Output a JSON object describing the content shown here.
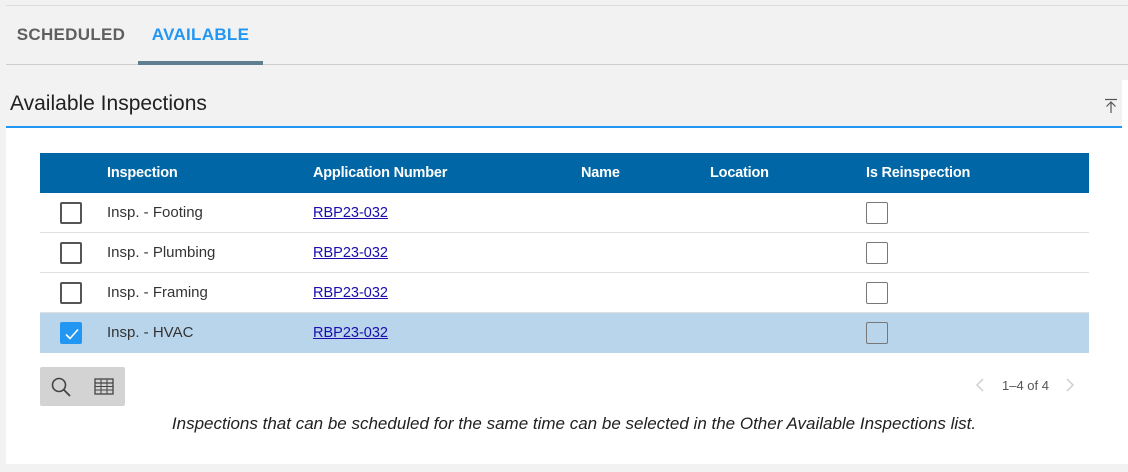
{
  "tabs": [
    {
      "label": "SCHEDULED",
      "active": false
    },
    {
      "label": "AVAILABLE",
      "active": true
    }
  ],
  "panel": {
    "title": "Available Inspections",
    "collapse_icon": "collapse-up-icon"
  },
  "grid": {
    "columns": [
      "Inspection",
      "Application Number",
      "Name",
      "Location",
      "Is Reinspection"
    ],
    "rows": [
      {
        "inspection": "Insp. - Footing",
        "application_number": "RBP23-032",
        "name": "",
        "location": "",
        "selected": false,
        "is_reinspection": false
      },
      {
        "inspection": "Insp. - Plumbing",
        "application_number": "RBP23-032",
        "name": "",
        "location": "",
        "selected": false,
        "is_reinspection": false
      },
      {
        "inspection": "Insp. - Framing",
        "application_number": "RBP23-032",
        "name": "",
        "location": "",
        "selected": false,
        "is_reinspection": false
      },
      {
        "inspection": "Insp. - HVAC",
        "application_number": "RBP23-032",
        "name": "",
        "location": "",
        "selected": true,
        "is_reinspection": false
      }
    ]
  },
  "toolbar": {
    "search_icon": "search-icon",
    "columns_icon": "table-columns-icon"
  },
  "pager": {
    "text": "1–4 of 4"
  },
  "note": "Inspections that can be scheduled for the same time can be selected in the Other Available Inspections list.",
  "colors": {
    "accent": "#2196f3",
    "header_bg": "#0066a5",
    "selected_row": "#b8d5ec",
    "tab_indicator": "#5f7f91",
    "link": "#1a0dab"
  }
}
